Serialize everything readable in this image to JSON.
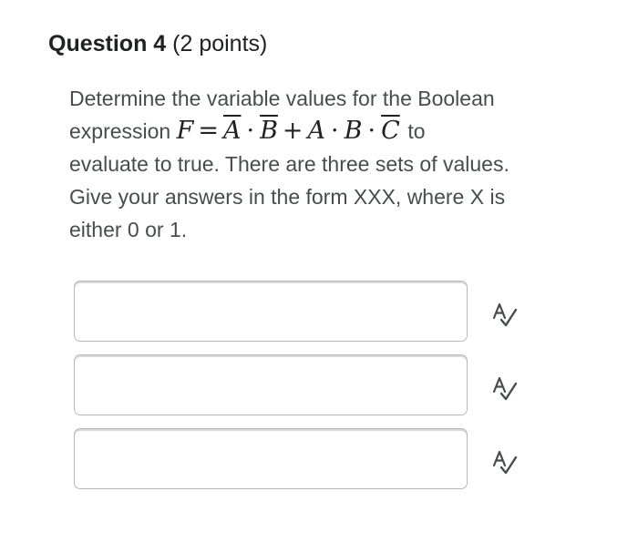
{
  "question": {
    "number_label": "Question 4",
    "points_label": "(2 points)"
  },
  "prompt": {
    "line1": "Determine the variable values for the Boolean",
    "line2_prefix": "expression",
    "line2_suffix": "to",
    "line3": "evaluate to true. There are three sets of values.",
    "line4": "Give your answers in the form XXX, where X is",
    "line5": "either 0 or 1."
  },
  "expression": {
    "lhs": "F",
    "equals": "=",
    "t1a": "A",
    "dot1": "·",
    "t1b": "B",
    "plus": "+",
    "t2a": "A",
    "dot2": "·",
    "t2b": "B",
    "dot3": "·",
    "t2c": "C"
  },
  "answers": [
    {
      "value": "",
      "placeholder": ""
    },
    {
      "value": "",
      "placeholder": ""
    },
    {
      "value": "",
      "placeholder": ""
    }
  ],
  "icons": {
    "spell_check": "spell-check-icon"
  }
}
